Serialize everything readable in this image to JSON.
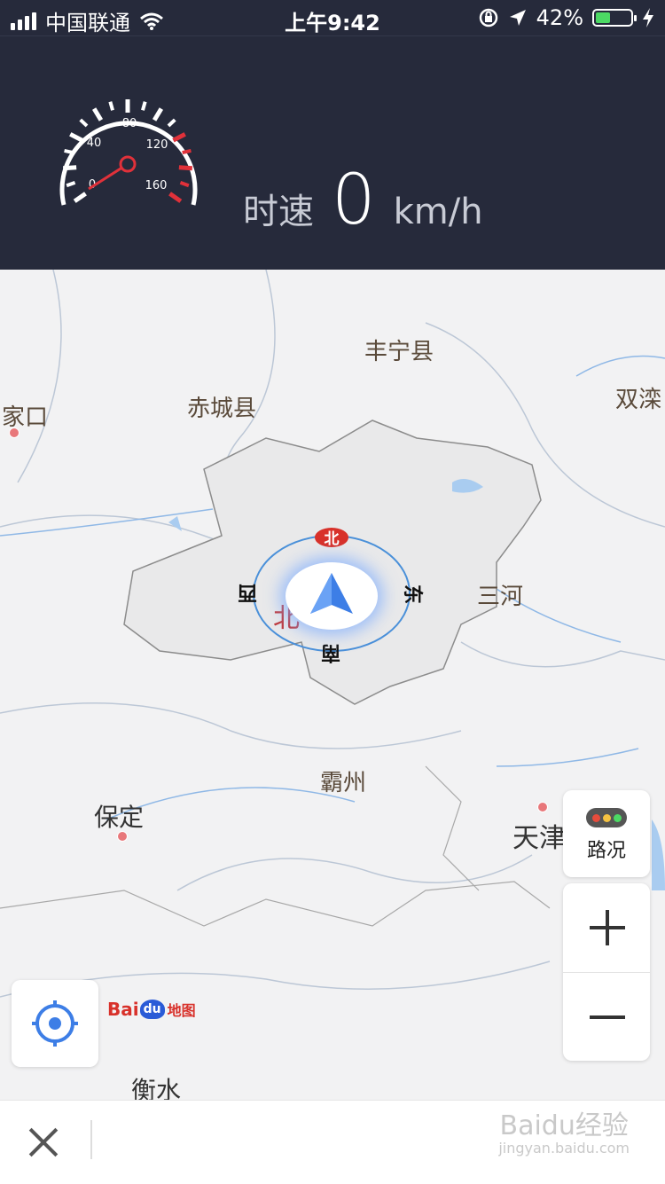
{
  "status_bar": {
    "carrier": "中国联通",
    "time": "上午9:42",
    "battery_percent": "42%",
    "battery_level": 0.42,
    "colors": {
      "battery_fill": "#4cd964"
    }
  },
  "speed_panel": {
    "label": "时速",
    "value": "0",
    "unit": "km/h",
    "gauge_ticks": [
      "0",
      "40",
      "80",
      "120",
      "160"
    ],
    "needle_value": 0,
    "colors": {
      "background": "#262a3b",
      "redline": "#e0313a"
    }
  },
  "map": {
    "places": {
      "fengning": "丰宁县",
      "chicheng": "赤城县",
      "zhangjiakou_partial": "家口",
      "shuangluan_partial": "双滦",
      "sanhe": "三河",
      "bazhou": "霸州",
      "baoding": "保定",
      "tianjin_partial": "天津",
      "hengshui": "衡水",
      "beijing_partial": "北"
    },
    "compass": {
      "north": "北",
      "south": "南",
      "east": "东",
      "west": "西"
    },
    "traffic_label": "路况",
    "logo": {
      "bai": "Bai",
      "du": "du",
      "map": "地图"
    }
  },
  "bottom_bar": {
    "watermark_main": "Baidu经验",
    "watermark_sub": "jingyan.baidu.com"
  },
  "icons": [
    "wifi-icon",
    "lock-rotation-icon",
    "location-arrow-icon",
    "charging-icon",
    "navigation-arrow-icon",
    "locate-icon",
    "zoom-in-icon",
    "zoom-out-icon",
    "close-icon",
    "traffic-light-icon"
  ]
}
